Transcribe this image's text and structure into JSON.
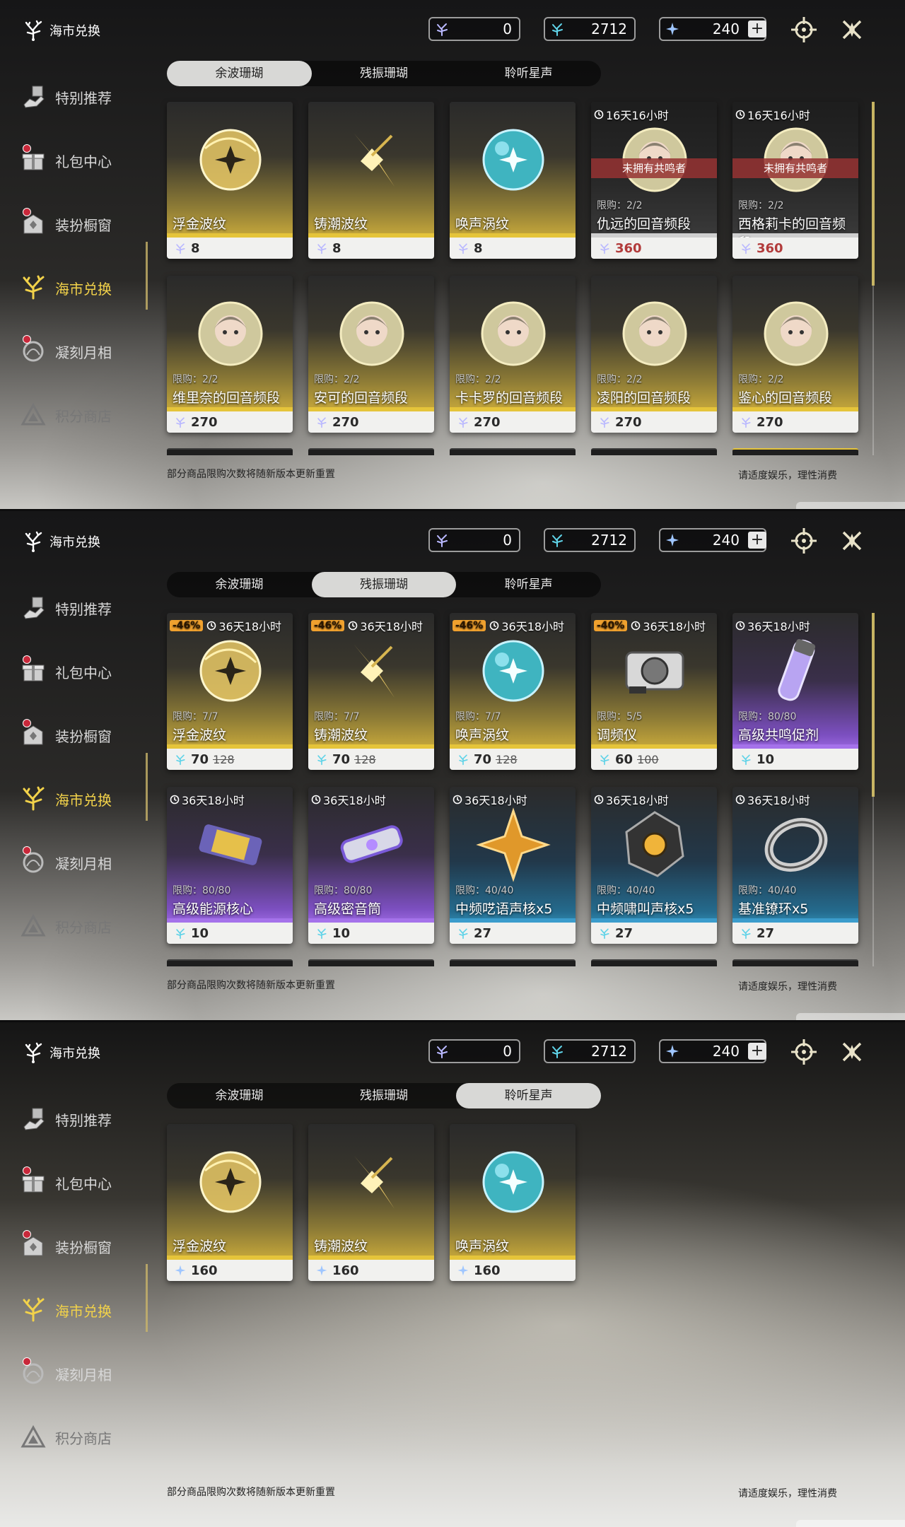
{
  "brand_title": "海市兑换",
  "nav": [
    {
      "label": "特别推荐"
    },
    {
      "label": "礼包中心"
    },
    {
      "label": "装扮橱窗"
    },
    {
      "label": "海市兑换"
    },
    {
      "label": "凝刻月相"
    },
    {
      "label": "积分商店"
    }
  ],
  "currency": {
    "a": "0",
    "b": "2712",
    "c": "240",
    "plus": "+"
  },
  "tabs": [
    "余波珊瑚",
    "残振珊瑚",
    "聆听星声"
  ],
  "footer_left": "部分商品限购次数将随新版本更新重置",
  "footer_right": "请适度娱乐，理性消费",
  "colors": {
    "accent": "#f2d24a",
    "discount": "#f0a12e",
    "notowned": "#963232"
  },
  "panel1": {
    "cards": [
      {
        "name": "浮金波纹",
        "price": "8",
        "icon": "gold-orb-icon"
      },
      {
        "name": "铸潮波纹",
        "price": "8",
        "icon": "gold-blade-icon"
      },
      {
        "name": "唤声涡纹",
        "price": "8",
        "icon": "teal-orb-icon"
      },
      {
        "name": "仇远的回音频段",
        "price": "360",
        "timer": "16天16小时",
        "banner": "未拥有共鸣者",
        "limit": "限购：2/2",
        "icon": "portrait-icon"
      },
      {
        "name": "西格莉卡的回音频段",
        "price": "360",
        "timer": "16天16小时",
        "banner": "未拥有共鸣者",
        "limit": "限购：2/2",
        "icon": "portrait-icon"
      },
      {
        "name": "维里奈的回音频段",
        "price": "270",
        "limit": "限购：2/2",
        "icon": "portrait-icon"
      },
      {
        "name": "安可的回音频段",
        "price": "270",
        "limit": "限购：2/2",
        "icon": "portrait-icon"
      },
      {
        "name": "卡卡罗的回音频段",
        "price": "270",
        "limit": "限购：2/2",
        "icon": "portrait-icon"
      },
      {
        "name": "凌阳的回音频段",
        "price": "270",
        "limit": "限购：2/2",
        "icon": "portrait-icon"
      },
      {
        "name": "鉴心的回音频段",
        "price": "270",
        "limit": "限购：2/2",
        "icon": "portrait-icon"
      }
    ]
  },
  "panel2": {
    "cards": [
      {
        "name": "浮金波纹",
        "price": "70",
        "old": "128",
        "discount": "-46%",
        "timer": "36天18小时",
        "limit": "限购：7/7",
        "icon": "gold-orb-icon"
      },
      {
        "name": "铸潮波纹",
        "price": "70",
        "old": "128",
        "discount": "-46%",
        "timer": "36天18小时",
        "limit": "限购：7/7",
        "icon": "gold-blade-icon"
      },
      {
        "name": "唤声涡纹",
        "price": "70",
        "old": "128",
        "discount": "-46%",
        "timer": "36天18小时",
        "limit": "限购：7/7",
        "icon": "teal-orb-icon"
      },
      {
        "name": "调频仪",
        "price": "60",
        "old": "100",
        "discount": "-40%",
        "timer": "36天18小时",
        "limit": "限购：5/5",
        "icon": "device-icon"
      },
      {
        "name": "高级共鸣促剂",
        "price": "10",
        "timer": "36天18小时",
        "limit": "限购：80/80",
        "icon": "vial-icon"
      },
      {
        "name": "高级能源核心",
        "price": "10",
        "timer": "36天18小时",
        "limit": "限购：80/80",
        "icon": "capsule-icon"
      },
      {
        "name": "高级密音筒",
        "price": "10",
        "timer": "36天18小时",
        "limit": "限购：80/80",
        "icon": "cylinder-icon"
      },
      {
        "name": "中频呓语声核x5",
        "price": "27",
        "timer": "36天18小时",
        "limit": "限购：40/40",
        "icon": "star-core-icon"
      },
      {
        "name": "中频啸叫声核x5",
        "price": "27",
        "timer": "36天18小时",
        "limit": "限购：40/40",
        "icon": "dark-core-icon"
      },
      {
        "name": "基准镣环x5",
        "price": "27",
        "timer": "36天18小时",
        "limit": "限购：40/40",
        "icon": "ring-icon"
      }
    ]
  },
  "panel3": {
    "cards": [
      {
        "name": "浮金波纹",
        "price": "160",
        "icon": "gold-orb-icon"
      },
      {
        "name": "铸潮波纹",
        "price": "160",
        "icon": "gold-blade-icon"
      },
      {
        "name": "唤声涡纹",
        "price": "160",
        "icon": "teal-orb-icon"
      }
    ]
  }
}
